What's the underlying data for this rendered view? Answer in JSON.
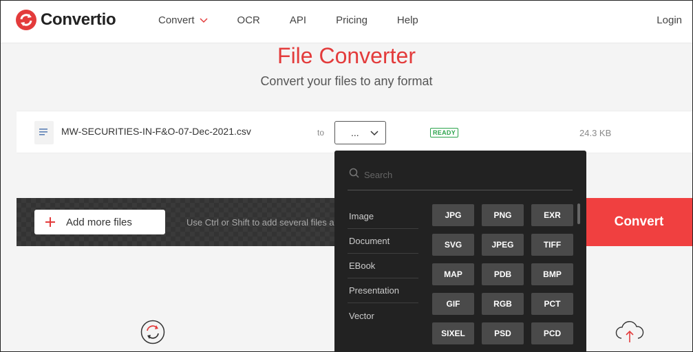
{
  "header": {
    "logo_text": "Convertio",
    "nav": [
      {
        "label": "Convert"
      },
      {
        "label": "OCR"
      },
      {
        "label": "API"
      },
      {
        "label": "Pricing"
      },
      {
        "label": "Help"
      }
    ],
    "login_label": "Login"
  },
  "hero": {
    "title": "File Converter",
    "subtitle": "Convert your files to any format"
  },
  "file": {
    "name": "MW-SECURITIES-IN-F&O-07-Dec-2021.csv",
    "to_label": "to",
    "selected_format": "...",
    "status": "READY",
    "size": "24.3 KB"
  },
  "actions": {
    "add_files_label": "Add more files",
    "hint": "Use Ctrl or Shift to add several files a",
    "convert_label": "Convert"
  },
  "dropdown": {
    "search_placeholder": "Search",
    "categories": [
      "Image",
      "Document",
      "EBook",
      "Presentation",
      "Vector"
    ],
    "formats": [
      "JPG",
      "PNG",
      "EXR",
      "SVG",
      "JPEG",
      "TIFF",
      "MAP",
      "PDB",
      "BMP",
      "GIF",
      "RGB",
      "PCT",
      "SIXEL",
      "PSD",
      "PCD"
    ]
  },
  "colors": {
    "brand_red": "#e33b3b",
    "convert_button": "#f04040",
    "ready_green": "#2aa34a",
    "dropdown_bg": "#222222"
  },
  "icons": {
    "logo": "convertio-logo-icon",
    "file": "document-lines-icon",
    "search": "search-icon",
    "refresh": "refresh-circle-icon",
    "upload": "cloud-upload-icon"
  }
}
